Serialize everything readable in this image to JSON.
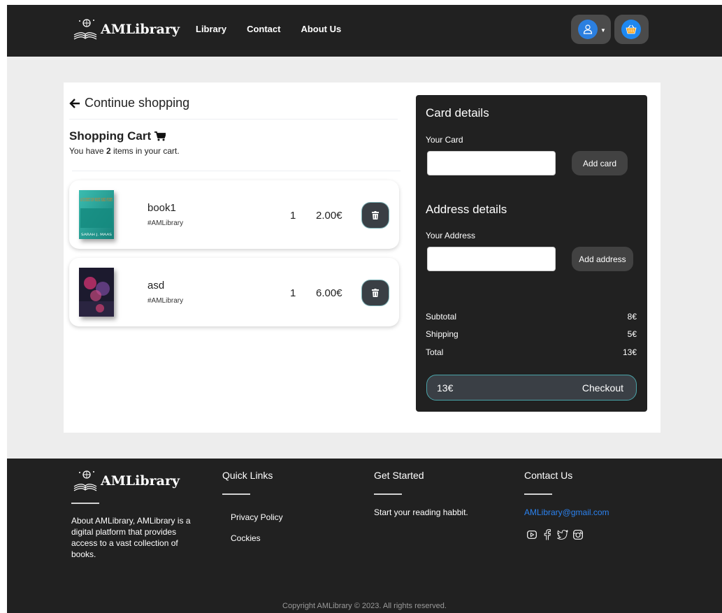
{
  "brand": {
    "name": "AMLibrary"
  },
  "nav": {
    "links": [
      "Library",
      "Contact",
      "About Us"
    ]
  },
  "header": {
    "user_icon": "user-icon",
    "cart_icon": "basket-icon"
  },
  "cart": {
    "continue_label": "Continue shopping",
    "title": "Shopping Cart",
    "subtitle_prefix": "You have ",
    "item_count": "2",
    "subtitle_suffix": " items in your cart.",
    "items": [
      {
        "title": "book1",
        "tag": "#AMLibrary",
        "qty": "1",
        "price": "2.00€",
        "cover_text": "A COURT OF MIST AND FURY",
        "cover_author": "SARAH J. MAAS"
      },
      {
        "title": "asd",
        "tag": "#AMLibrary",
        "qty": "1",
        "price": "6.00€"
      }
    ]
  },
  "panel": {
    "card_title": "Card details",
    "card_label": "Your Card",
    "card_value": "",
    "add_card": "Add card",
    "address_title": "Address details",
    "address_label": "Your Address",
    "address_value": "",
    "add_address": "Add address",
    "subtotal_label": "Subtotal",
    "subtotal": "8€",
    "shipping_label": "Shipping",
    "shipping": "5€",
    "total_label": "Total",
    "total": "13€",
    "checkout_amount": "13€",
    "checkout_label": "Checkout"
  },
  "footer": {
    "brand": "AMLibrary",
    "about": "About AMLibrary, AMLibrary is a digital platform that provides access to a vast collection of books.",
    "quick_links_title": "Quick Links",
    "quick_links": [
      "Privacy Policy",
      "Cockies"
    ],
    "get_started_title": "Get Started",
    "get_started_text": "Start your reading habbit.",
    "contact_title": "Contact Us",
    "email": "AMLibrary@gmail.com",
    "socials": [
      "youtube-icon",
      "facebook-icon",
      "twitter-icon",
      "instagram-icon"
    ],
    "copyright": "Copyright AMLibrary © 2023. All rights reserved."
  },
  "colors": {
    "dark": "#212121",
    "accent_blue": "#2b82ef",
    "teal": "#4aa3a8"
  }
}
